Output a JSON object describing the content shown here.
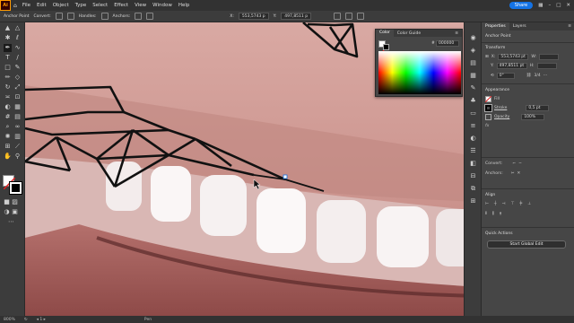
{
  "app": {
    "logo": "Ai"
  },
  "menus": [
    "File",
    "Edit",
    "Object",
    "Type",
    "Select",
    "Effect",
    "View",
    "Window",
    "Help"
  ],
  "topright": {
    "share": "Share"
  },
  "control": {
    "label": "Anchor Point",
    "convert": "Convert:",
    "handles": "Handles:",
    "anchors": "Anchors:",
    "x": "553,5743 p",
    "y": "497,8511 p"
  },
  "color_panel": {
    "tab1": "Color",
    "tab2": "Color Guide",
    "hex_label": "#",
    "hex": "000000"
  },
  "props": {
    "tab1": "Properties",
    "tab2": "Layers",
    "selection": "Anchor Point",
    "transform_title": "Transform",
    "x_label": "X:",
    "x": "553,5743 pt",
    "y_label": "Y:",
    "y": "497,8511 pt",
    "w_label": "W:",
    "h_label": "H:",
    "angle": "0°",
    "ratio": "3/4",
    "appearance_title": "Appearance",
    "fill_label": "Fill",
    "stroke_label": "Stroke",
    "stroke": "0,5 pt",
    "opacity_label": "Opacity",
    "opacity": "100%",
    "fx": "fx",
    "convert_label": "Convert:",
    "anchors_label": "Anchors:",
    "align_title": "Align",
    "quick_title": "Quick Actions",
    "start_global_edit": "Start Global Edit"
  },
  "status": {
    "zoom": "800%",
    "tool": "Pen"
  },
  "colors": {
    "accent": "#1473e6",
    "canvas_skin": "#c99a95",
    "ui_dark": "#323232"
  }
}
